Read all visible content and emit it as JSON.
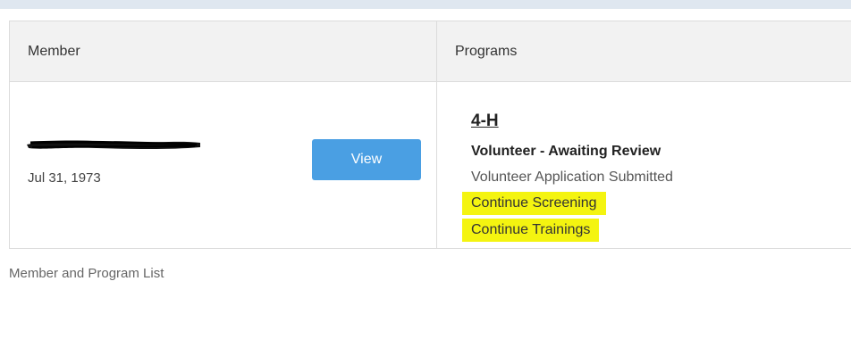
{
  "table": {
    "headers": {
      "member": "Member",
      "programs": "Programs"
    },
    "rows": [
      {
        "member": {
          "dob": "Jul 31, 1973",
          "view_label": "View"
        },
        "program": {
          "name": "4-H",
          "status": "Volunteer - Awaiting Review",
          "substatus": "Volunteer Application Submitted",
          "links": [
            "Continue Screening",
            "Continue Trainings"
          ]
        }
      }
    ]
  },
  "caption": "Member and Program List",
  "colors": {
    "button": "#4a9fe3",
    "highlight": "#f4f410",
    "header_bg": "#f2f2f2"
  }
}
